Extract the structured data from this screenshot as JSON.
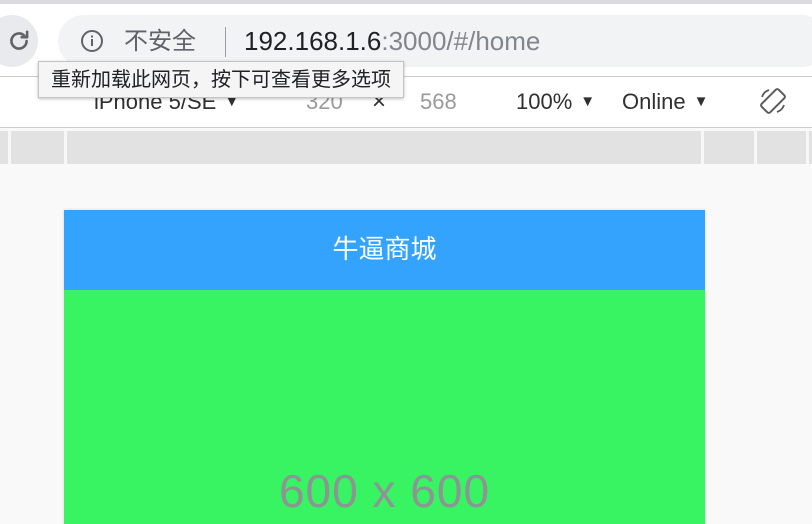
{
  "browser": {
    "security_label": "不安全",
    "url_host": "192.168.1.6",
    "url_rest": ":3000/#/home",
    "reload_tooltip": "重新加载此网页，按下可查看更多选项"
  },
  "device_toolbar": {
    "device": "iPhone 5/SE",
    "width": "320",
    "times": "×",
    "height": "568",
    "zoom": "100%",
    "throttling": "Online",
    "caret": "▼"
  },
  "app": {
    "title": "牛逼商城",
    "banner_placeholder": "600 x 600",
    "colors": {
      "header_bg": "#33a3fd",
      "banner_bg": "#38f463"
    }
  },
  "icons": [
    "reload-icon",
    "info-icon",
    "rotate-device-icon"
  ]
}
